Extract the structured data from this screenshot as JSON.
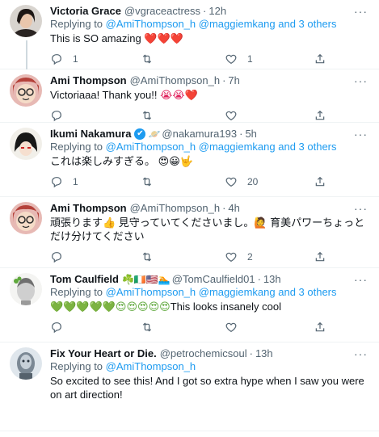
{
  "tweets": [
    {
      "name": "Victoria Grace",
      "handle": "@vgraceactress",
      "time": "12h",
      "reply_prefix": "Replying to",
      "reply_mentions": "@AmiThompson_h @maggiemkang",
      "reply_suffix": "and 3 others",
      "text": "This is SO amazing",
      "text_emoji": "❤️❤️❤️",
      "replies": "1",
      "retweets": "",
      "likes": "1"
    },
    {
      "name": "Ami Thompson",
      "handle": "@AmiThompson_h",
      "time": "7h",
      "text": "Victoriaaa! Thank you!!",
      "text_emoji": "😭😭❤️",
      "replies": "",
      "retweets": "",
      "likes": ""
    },
    {
      "name": "Ikumi Nakamura",
      "name_badges": "🪐 ✔",
      "handle": "@nakamura193",
      "time": "5h",
      "reply_prefix": "Replying to",
      "reply_mentions": "@AmiThompson_h @maggiemkang",
      "reply_suffix": "and 3 others",
      "text": "これは楽しみすぎる。",
      "text_emoji": "😍😀🤟",
      "replies": "1",
      "retweets": "",
      "likes": "20"
    },
    {
      "name": "Ami Thompson",
      "handle": "@AmiThompson_h",
      "time": "4h",
      "text": "頑張ります👍 見守っていてくださいまし。🙋 育美パワーちょっとだけ分けてください",
      "replies": "",
      "retweets": "",
      "likes": "2"
    },
    {
      "name": "Tom Caulfield",
      "name_badges": "☘️🇮🇪🇺🇸🏊",
      "handle": "@TomCaulfield01",
      "time": "13h",
      "reply_prefix": "Replying to",
      "reply_mentions": "@AmiThompson_h @maggiemkang",
      "reply_suffix": "and 3 others",
      "text_emoji": "💚💚💚💚💚😍😍😍😍😍",
      "text": "This looks insanely cool",
      "replies": "",
      "retweets": "",
      "likes": ""
    },
    {
      "name": "Fix Your Heart or Die.",
      "handle": "@petrochemicsoul",
      "time": "13h",
      "reply_prefix": "Replying to",
      "reply_mentions": "@AmiThompson_h",
      "text": "So excited to see this!  And I got so extra hype when I saw you were on art direction!",
      "replies": "",
      "retweets": "",
      "likes": ""
    }
  ],
  "sep": "·",
  "more": "···",
  "icons": [
    "reply-icon",
    "retweet-icon",
    "like-icon",
    "share-icon",
    "more-icon",
    "verified-icon"
  ],
  "colors": {
    "link": "#1d9bf0",
    "muted": "#536471",
    "heart": "#e0245e",
    "thread": "#cfd9de"
  }
}
